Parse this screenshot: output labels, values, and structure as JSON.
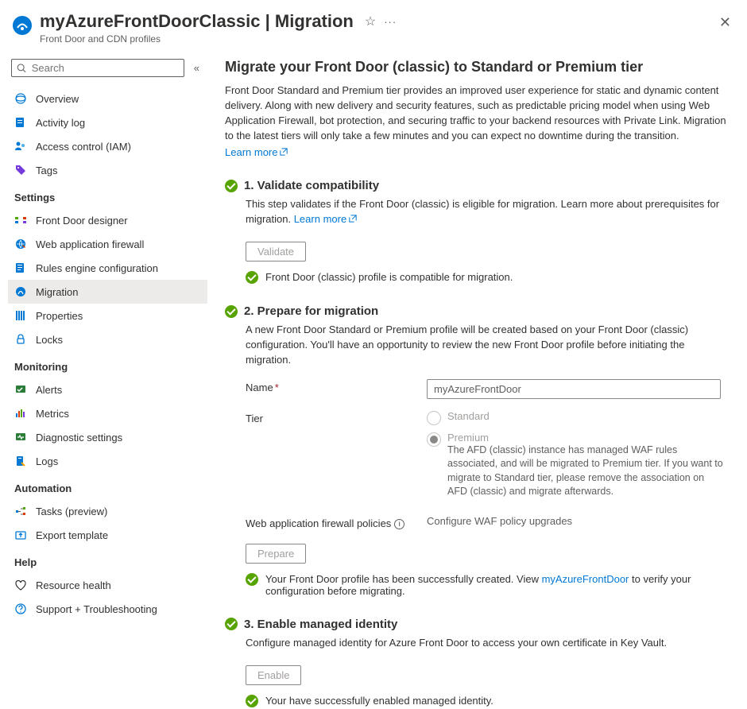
{
  "header": {
    "title": "myAzureFrontDoorClassic | Migration",
    "subtitle": "Front Door and CDN profiles"
  },
  "search": {
    "placeholder": "Search"
  },
  "nav": {
    "top": [
      {
        "key": "overview",
        "label": "Overview",
        "color": "#0078d4"
      },
      {
        "key": "activity",
        "label": "Activity log",
        "color": "#0078d4"
      },
      {
        "key": "iam",
        "label": "Access control (IAM)",
        "color": "#0078d4"
      },
      {
        "key": "tags",
        "label": "Tags",
        "color": "#773adc"
      }
    ],
    "sections": [
      {
        "title": "Settings",
        "items": [
          {
            "key": "designer",
            "label": "Front Door designer"
          },
          {
            "key": "waf",
            "label": "Web application firewall"
          },
          {
            "key": "rules",
            "label": "Rules engine configuration"
          },
          {
            "key": "migration",
            "label": "Migration",
            "selected": true
          },
          {
            "key": "properties",
            "label": "Properties"
          },
          {
            "key": "locks",
            "label": "Locks"
          }
        ]
      },
      {
        "title": "Monitoring",
        "items": [
          {
            "key": "alerts",
            "label": "Alerts"
          },
          {
            "key": "metrics",
            "label": "Metrics"
          },
          {
            "key": "diag",
            "label": "Diagnostic settings"
          },
          {
            "key": "logs",
            "label": "Logs"
          }
        ]
      },
      {
        "title": "Automation",
        "items": [
          {
            "key": "tasks",
            "label": "Tasks (preview)"
          },
          {
            "key": "export",
            "label": "Export template"
          }
        ]
      },
      {
        "title": "Help",
        "items": [
          {
            "key": "reshealth",
            "label": "Resource health"
          },
          {
            "key": "support",
            "label": "Support + Troubleshooting"
          }
        ]
      }
    ]
  },
  "main": {
    "title": "Migrate your Front Door (classic) to Standard or Premium tier",
    "intro": "Front Door Standard and Premium tier provides an improved user experience for static and dynamic content delivery. Along with new delivery and security features, such as predictable pricing model when using Web Application Firewall, bot protection, and securing traffic to your backend resources with Private Link. Migration to the latest tiers will only take a few minutes and you can expect no downtime during the transition.",
    "learn_more": "Learn more"
  },
  "step1": {
    "title": "1. Validate compatibility",
    "desc_a": "This step validates if the Front Door (classic) is eligible for migration. Learn more about prerequisites for migration. ",
    "learn_more": "Learn more",
    "button": "Validate",
    "status": "Front Door (classic) profile is compatible for migration."
  },
  "step2": {
    "title": "2. Prepare for migration",
    "desc": "A new Front Door Standard or Premium profile will be created based on your Front Door (classic) configuration. You'll have an opportunity to review the new Front Door profile before initiating the migration.",
    "name_label": "Name",
    "name_value": "myAzureFrontDoor",
    "tier_label": "Tier",
    "tier_standard": "Standard",
    "tier_premium": "Premium",
    "tier_note": "The AFD (classic) instance has managed WAF rules associated, and will be migrated to Premium tier. If you want to migrate to Standard tier, please remove the association on AFD (classic) and migrate afterwards.",
    "waf_label": "Web application firewall policies",
    "waf_value": "Configure WAF policy upgrades",
    "button": "Prepare",
    "status_a": "Your Front Door profile has been successfully created. View ",
    "status_link": "myAzureFrontDoor",
    "status_b": " to verify your configuration before migrating."
  },
  "step3": {
    "title": "3. Enable managed identity",
    "desc": "Configure managed identity for Azure Front Door to access your own certificate in Key Vault.",
    "button": "Enable",
    "status": "Your have successfully enabled managed identity."
  }
}
